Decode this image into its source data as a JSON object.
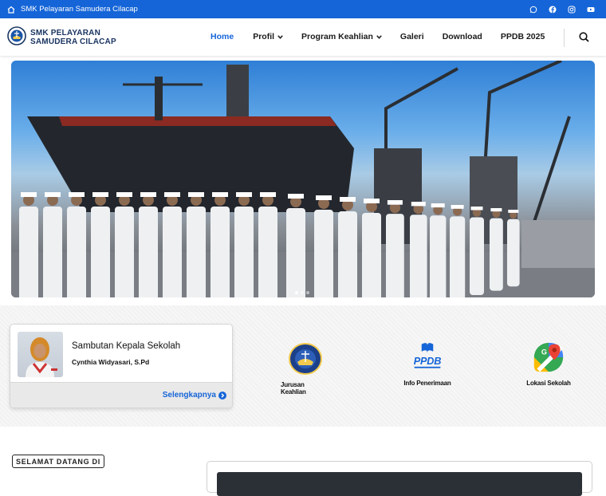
{
  "topbar": {
    "site_name": "SMK Pelayaran Samudera Cilacap",
    "bg_color": "#1565d8",
    "socials": [
      "whatsapp-icon",
      "facebook-icon",
      "instagram-icon",
      "youtube-icon"
    ]
  },
  "header": {
    "brand_line1": "SMK PELAYARAN",
    "brand_line2": "SAMUDERA CILACAP",
    "nav": [
      {
        "label": "Home",
        "active": true
      },
      {
        "label": "Profil",
        "dropdown": true
      },
      {
        "label": "Program Keahlian",
        "dropdown": true
      },
      {
        "label": "Galeri"
      },
      {
        "label": "Download"
      },
      {
        "label": "PPDB 2025"
      }
    ]
  },
  "principal_card": {
    "title": "Sambutan Kepala Sekolah",
    "name": "Cynthia Widyasari, S.Pd",
    "more_label": "Selengkapnya"
  },
  "features": [
    {
      "label": "Jurusan Keahlian",
      "icon": "school-emblem-icon"
    },
    {
      "label": "Info Penerimaan",
      "icon": "ppdb-book-icon"
    },
    {
      "label": "Lokasi Sekolah",
      "icon": "map-location-icon"
    }
  ],
  "ppdb_logo_text": "PPDB",
  "welcome": {
    "label": "SELAMAT DATANG DI"
  },
  "colors": {
    "accent": "#1565d8",
    "brand": "#1a3561"
  }
}
